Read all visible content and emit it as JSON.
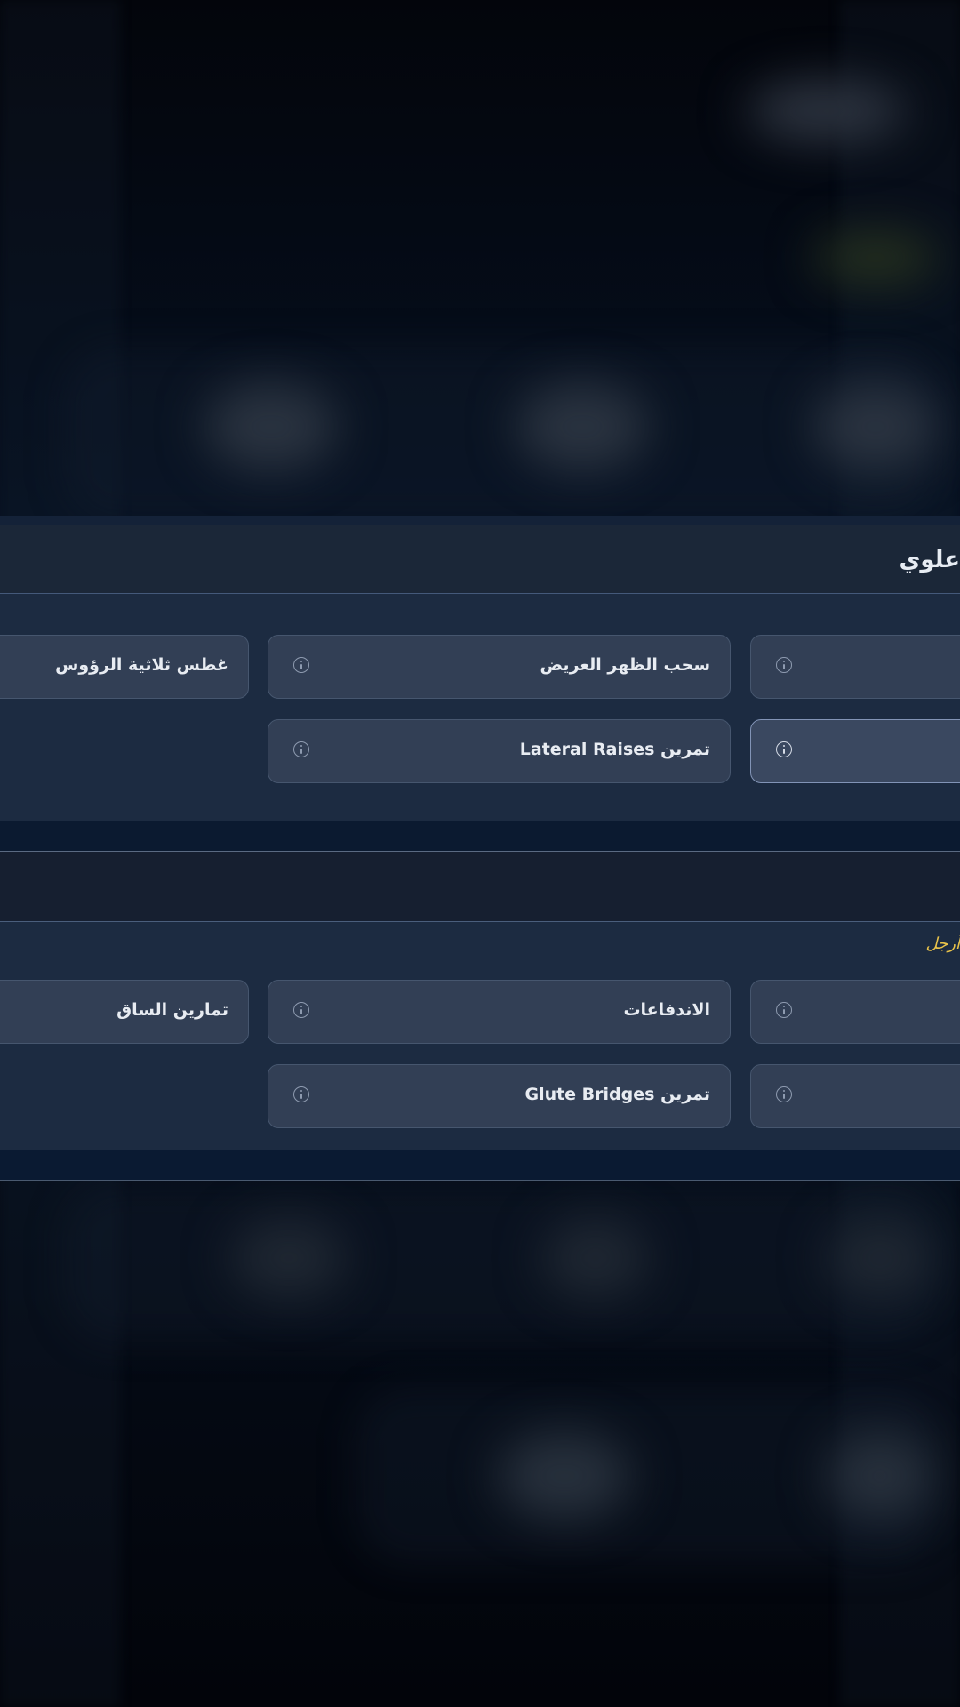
{
  "sections": [
    {
      "title": "علوي",
      "subtitle": "",
      "exercises": [
        {
          "label": "غطس ثلاثية الرؤوس"
        },
        {
          "label": "سحب الظهر العريض"
        },
        {
          "label": ""
        },
        {
          "label": "تمرين Lateral Raises"
        },
        {
          "label": ""
        }
      ]
    },
    {
      "title": "",
      "subtitle": "أرجل",
      "exercises": [
        {
          "label": "تمارين الساق"
        },
        {
          "label": "الاندفاعات"
        },
        {
          "label": ""
        },
        {
          "label": "تمرين Glute Bridges"
        },
        {
          "label": ""
        }
      ]
    }
  ],
  "colors": {
    "card": "#323f55",
    "card_selected": "#3a4860",
    "accent_yellow": "#e9c34a",
    "text": "#e8ecf2"
  }
}
